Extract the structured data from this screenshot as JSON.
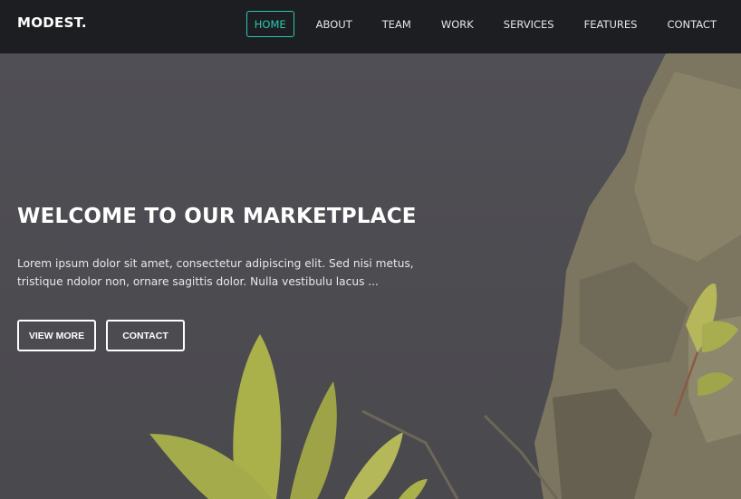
{
  "brand": {
    "logo_text": "MODEST."
  },
  "nav": {
    "items": [
      {
        "label": "HOME",
        "active": true
      },
      {
        "label": "ABOUT",
        "active": false
      },
      {
        "label": "TEAM",
        "active": false
      },
      {
        "label": "WORK",
        "active": false
      },
      {
        "label": "SERVICES",
        "active": false
      },
      {
        "label": "FEATURES",
        "active": false
      },
      {
        "label": "CONTACT",
        "active": false
      }
    ]
  },
  "hero": {
    "title": "WELCOME TO OUR MARKETPLACE",
    "text": "Lorem ipsum dolor sit amet, consectetur adipiscing elit. Sed nisi metus, tristique ndolor non, ornare sagittis dolor. Nulla vestibulu lacus ...",
    "buttons": {
      "view_more": "VIEW MORE",
      "contact": "CONTACT"
    }
  },
  "colors": {
    "accent": "#2bc7b3",
    "navbar": "#1c1e22"
  }
}
